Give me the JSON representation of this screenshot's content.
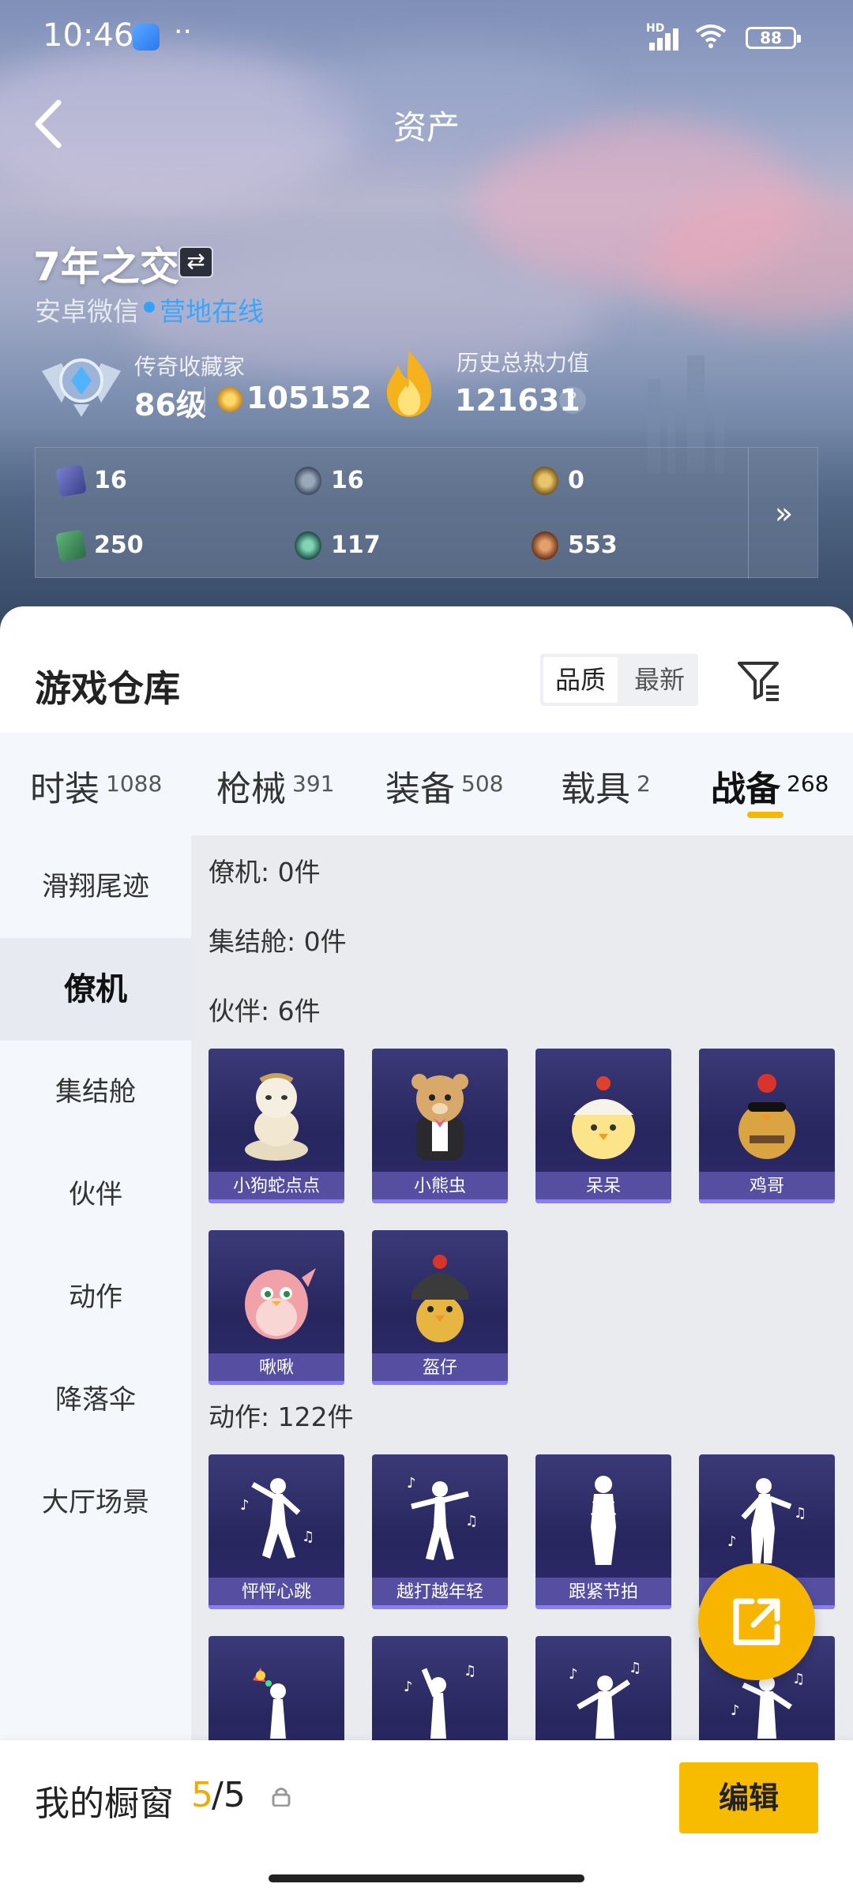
{
  "status_bar": {
    "time": "10:46",
    "dots": "··",
    "network": "HD",
    "battery": "88"
  },
  "header": {
    "title": "资产"
  },
  "profile": {
    "username": "7年之交",
    "platform": "安卓微信",
    "online_status": "营地在线",
    "online_color": "#3aa4ff"
  },
  "rank": {
    "title": "传奇收藏家",
    "level": "86级",
    "coins": "105152"
  },
  "heat": {
    "title": "历史总热力值",
    "value": "121631",
    "help": "?"
  },
  "stats": [
    {
      "icon": "card-icon",
      "value": "16"
    },
    {
      "icon": "medal-icon",
      "value": "16"
    },
    {
      "icon": "gold-medal-icon",
      "value": "0"
    },
    {
      "icon": "ticket-icon",
      "value": "250"
    },
    {
      "icon": "emerald-icon",
      "value": "117"
    },
    {
      "icon": "bronze-coin-icon",
      "value": "553"
    }
  ],
  "stats_more": "»",
  "warehouse": {
    "title": "游戏仓库",
    "sort_options": [
      "品质",
      "最新"
    ],
    "sort_active": "品质"
  },
  "tabs": [
    {
      "label": "时装",
      "count": "1088"
    },
    {
      "label": "枪械",
      "count": "391"
    },
    {
      "label": "装备",
      "count": "508"
    },
    {
      "label": "载具",
      "count": "2"
    },
    {
      "label": "战备",
      "count": "268",
      "active": true
    }
  ],
  "accent_color": "#f5b800",
  "categories": [
    {
      "label": "滑翔尾迹"
    },
    {
      "label": "僚机",
      "active": true
    },
    {
      "label": "集结舱"
    },
    {
      "label": "伙伴"
    },
    {
      "label": "动作"
    },
    {
      "label": "降落伞"
    },
    {
      "label": "大厅场景"
    }
  ],
  "sections": {
    "wingman": "僚机: 0件",
    "capsule": "集结舱: 0件",
    "partner": "伙伴: 6件",
    "emote": "动作: 122件"
  },
  "partners": [
    "小狗蛇点点",
    "小熊虫",
    "呆呆",
    "鸡哥",
    "啾啾",
    "盔仔"
  ],
  "emotes": [
    "怦怦心跳",
    "越打越年轻",
    "跟紧节拍",
    "",
    "",
    "",
    "",
    ""
  ],
  "showcase": {
    "label": "我的橱窗",
    "count": "5",
    "total": "/5",
    "edit_label": "编辑"
  }
}
